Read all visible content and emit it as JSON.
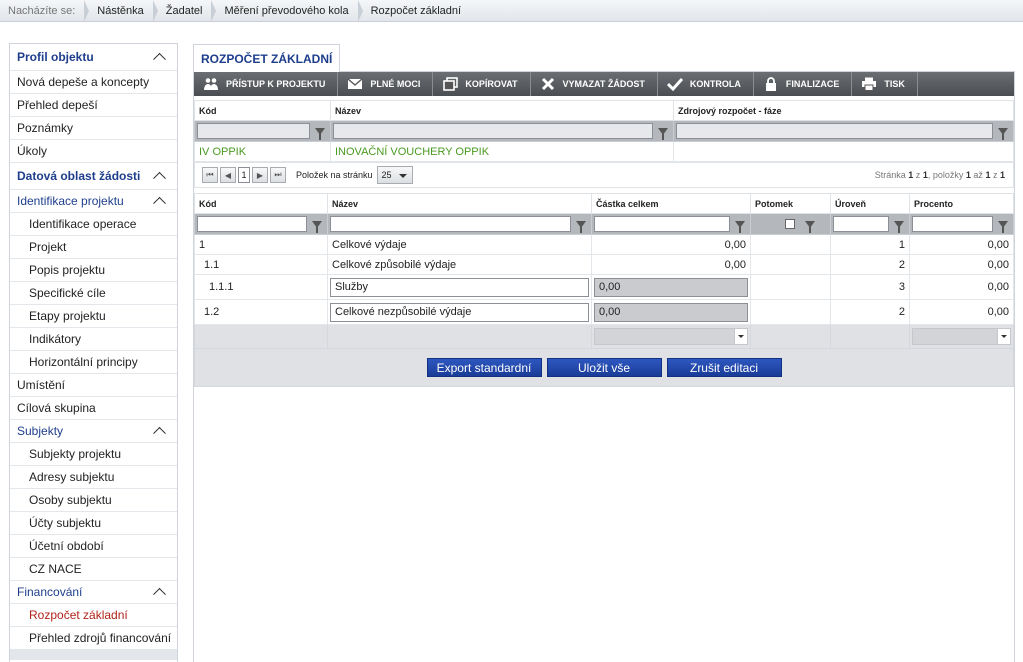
{
  "breadcrumb": {
    "prefix": "Nacházíte se:",
    "items": [
      "Nástěnka",
      "Žadatel",
      "Měření převodového kola",
      "Rozpočet základní"
    ]
  },
  "sidebar": {
    "items": [
      {
        "label": "Profil objektu",
        "kind": "head",
        "chevron": true
      },
      {
        "label": "Nová depeše a koncepty",
        "kind": "item"
      },
      {
        "label": "Přehled depeší",
        "kind": "item"
      },
      {
        "label": "Poznámky",
        "kind": "item"
      },
      {
        "label": "Úkoly",
        "kind": "item"
      },
      {
        "label": "Datová oblast žádosti",
        "kind": "head",
        "chevron": true
      },
      {
        "label": "Identifikace projektu",
        "kind": "group",
        "chevron": true
      },
      {
        "label": "Identifikace operace",
        "kind": "sub"
      },
      {
        "label": "Projekt",
        "kind": "sub"
      },
      {
        "label": "Popis projektu",
        "kind": "sub"
      },
      {
        "label": "Specifické cíle",
        "kind": "sub"
      },
      {
        "label": "Etapy projektu",
        "kind": "sub"
      },
      {
        "label": "Indikátory",
        "kind": "sub"
      },
      {
        "label": "Horizontální principy",
        "kind": "sub"
      },
      {
        "label": "Umístění",
        "kind": "item"
      },
      {
        "label": "Cílová skupina",
        "kind": "item"
      },
      {
        "label": "Subjekty",
        "kind": "group",
        "chevron": true
      },
      {
        "label": "Subjekty projektu",
        "kind": "sub"
      },
      {
        "label": "Adresy subjektu",
        "kind": "sub"
      },
      {
        "label": "Osoby subjektu",
        "kind": "sub"
      },
      {
        "label": "Účty subjektu",
        "kind": "sub"
      },
      {
        "label": "Účetní období",
        "kind": "sub"
      },
      {
        "label": "CZ NACE",
        "kind": "sub"
      },
      {
        "label": "Financování",
        "kind": "group",
        "chevron": true
      },
      {
        "label": "Rozpočet základní",
        "kind": "sub",
        "active": true
      },
      {
        "label": "Přehled zdrojů financování",
        "kind": "sub"
      }
    ]
  },
  "tab": {
    "label": "ROZPOČET ZÁKLADNÍ"
  },
  "toolbar": {
    "buttons": [
      {
        "label": "PŘÍSTUP K PROJEKTU",
        "icon": "people-icon"
      },
      {
        "label": "PLNÉ MOCI",
        "icon": "envelope-icon"
      },
      {
        "label": "KOPÍROVAT",
        "icon": "copy-icon"
      },
      {
        "label": "VYMAZAT ŽÁDOST",
        "icon": "delete-icon"
      },
      {
        "label": "KONTROLA",
        "icon": "check-icon"
      },
      {
        "label": "FINALIZACE",
        "icon": "lock-icon"
      },
      {
        "label": "TISK",
        "icon": "printer-icon"
      }
    ]
  },
  "budget_grid": {
    "headers": [
      "Kód",
      "Název",
      "Zdrojový rozpočet - fáze"
    ],
    "rows": [
      {
        "code": "IV OPPIK",
        "name": "INOVAČNÍ VOUCHERY OPPIK",
        "phase": ""
      }
    ]
  },
  "pager": {
    "first": "⏮",
    "prev": "◀",
    "page": "1",
    "next": "▶",
    "last": "⏭",
    "page_size_label": "Položek na stránku",
    "page_size": "25",
    "info": {
      "page_word": "Stránka",
      "page": "1",
      "of": "z",
      "pages": "1",
      "items_word": ", položky",
      "from": "1",
      "to_word": "až",
      "to": "1",
      "total_of": "z",
      "total": "1"
    }
  },
  "items_grid": {
    "headers": [
      "Kód",
      "Název",
      "Částka celkem",
      "Potomek",
      "Úroveň",
      "Procento"
    ],
    "rows": [
      {
        "code": "1",
        "name": "Celkové výdaje",
        "amount": "0,00",
        "child": "",
        "level": "1",
        "percent": "0,00",
        "editable": false
      },
      {
        "code": "1.1",
        "name": "Celkové způsobilé výdaje",
        "amount": "0,00",
        "child": "",
        "level": "2",
        "percent": "0,00",
        "editable": false
      },
      {
        "code": "1.1.1",
        "name": "Služby",
        "amount": "0,00",
        "child": "",
        "level": "3",
        "percent": "0,00",
        "editable": true
      },
      {
        "code": "1.2",
        "name": "Celkové nezpůsobilé výdaje",
        "amount": "0,00",
        "child": "",
        "level": "2",
        "percent": "0,00",
        "editable": true
      }
    ]
  },
  "actions": {
    "export": "Export standardní",
    "save": "Uložit vše",
    "cancel": "Zrušit editaci"
  },
  "colors": {
    "accent": "#1e3e8c",
    "active": "#b0231a",
    "green": "#4a9a21",
    "toolbar": "#555a5f",
    "button": "#2347a8"
  }
}
